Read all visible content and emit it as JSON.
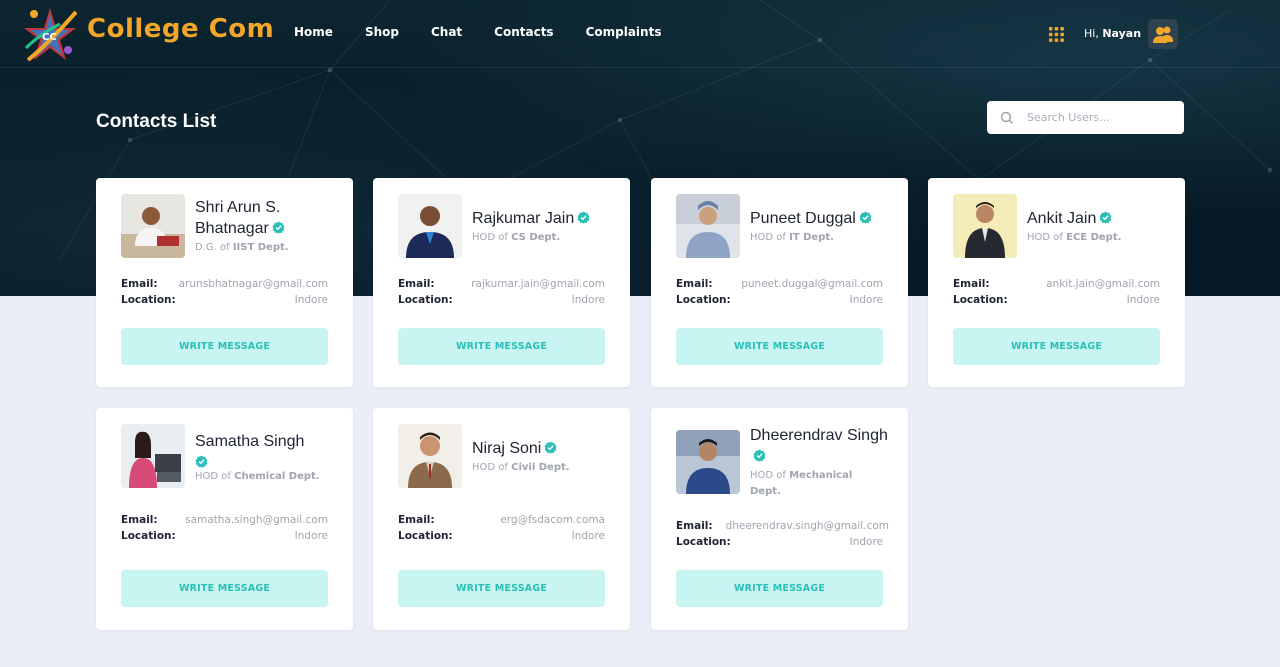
{
  "header": {
    "brand": "College Com",
    "nav": [
      "Home",
      "Shop",
      "Chat",
      "Contacts",
      "Complaints"
    ],
    "greeting_prefix": "Hi,",
    "user_name": "Nayan"
  },
  "page": {
    "title": "Contacts List",
    "search_placeholder": "Search Users..."
  },
  "labels": {
    "email": "Email:",
    "location": "Location:",
    "write_message": "WRITE MESSAGE"
  },
  "contacts": [
    {
      "name": "Shri Arun S. Bhatnagar",
      "title_prefix": "D.G. of",
      "dept": "IIST Dept.",
      "email": "arunsbhatnagar@gmail.com",
      "location": "Indore"
    },
    {
      "name": "Rajkumar Jain",
      "title_prefix": "HOD of",
      "dept": "CS Dept.",
      "email": "rajkumar.jain@gmail.com",
      "location": "Indore"
    },
    {
      "name": "Puneet Duggal",
      "title_prefix": "HOD of",
      "dept": "IT Dept.",
      "email": "puneet.duggal@gmail.com",
      "location": "Indore"
    },
    {
      "name": "Ankit Jain",
      "title_prefix": "HOD of",
      "dept": "ECE Dept.",
      "email": "ankit.jain@gmail.com",
      "location": "Indore"
    },
    {
      "name": "Samatha Singh",
      "title_prefix": "HOD of",
      "dept": "Chemical Dept.",
      "email": "samatha.singh@gmail.com",
      "location": "Indore"
    },
    {
      "name": "Niraj Soni",
      "title_prefix": "HOD of",
      "dept": "Civil Dept.",
      "email": "erg@fsdacom.coma",
      "location": "Indore"
    },
    {
      "name": "Dheerendrav Singh",
      "title_prefix": "HOD of",
      "dept": "Mechanical Dept.",
      "email": "dheerendrav.singh@gmail.com",
      "location": "Indore"
    }
  ],
  "colors": {
    "brand": "#f4a62a",
    "verified": "#2bbfb7",
    "button_bg": "#c8f4f2",
    "hero_bg": "#081c28"
  },
  "icons": {
    "logo": "college-com-logo",
    "apps": "grid-icon",
    "profile": "user-group-icon",
    "search": "search-icon",
    "verified": "verified-badge-icon"
  }
}
